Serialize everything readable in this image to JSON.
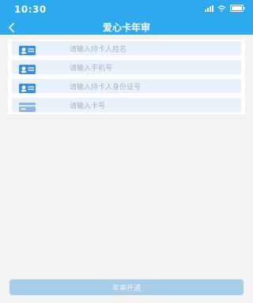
{
  "status_bar": {
    "time": "10:30",
    "icons": [
      "signal-icon",
      "wifi-icon",
      "battery-icon"
    ]
  },
  "nav": {
    "title": "爱心卡年审",
    "back_icon": "chevron-left-icon"
  },
  "form": {
    "fields": [
      {
        "icon": "id-card-icon",
        "placeholder": "请输入持卡人姓名"
      },
      {
        "icon": "id-card-icon",
        "placeholder": "请输入手机号"
      },
      {
        "icon": "id-card-icon",
        "placeholder": "请输入持卡人身份证号"
      },
      {
        "icon": "card-icon",
        "placeholder": "请输入卡号"
      }
    ]
  },
  "actions": {
    "submit_label": "年审开通"
  },
  "colors": {
    "header": "#2ea8ee",
    "field_bg": "#e9f2fb",
    "button_disabled": "#a8cde9"
  }
}
